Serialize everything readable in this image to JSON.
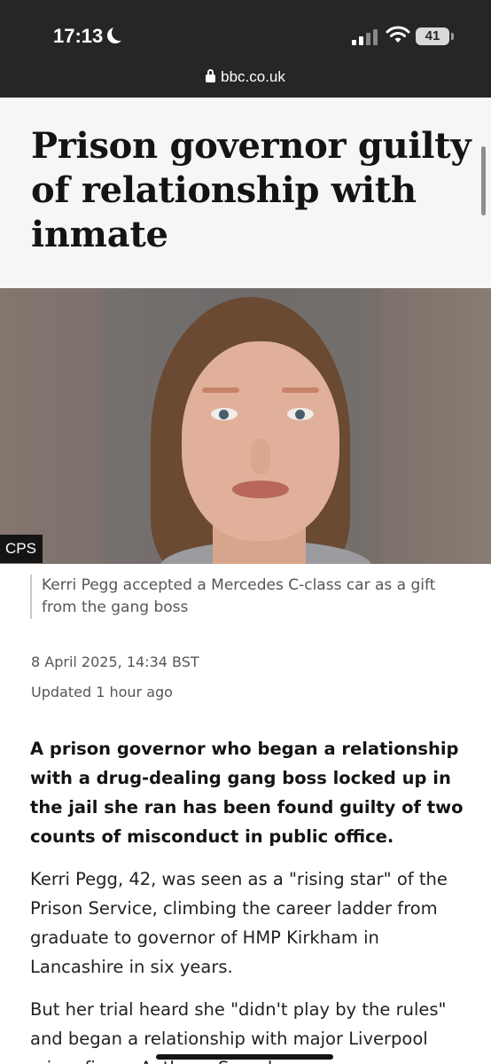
{
  "status_bar": {
    "time": "17:13",
    "battery": "41",
    "icons": [
      "moon-icon",
      "cellular-signal-icon",
      "wifi-icon",
      "battery-icon"
    ]
  },
  "browser": {
    "url": "bbc.co.uk"
  },
  "article": {
    "headline": "Prison governor guilty of relationship with inmate",
    "image_credit": "CPS",
    "caption": "Kerri Pegg accepted a Mercedes C-class car as a gift from the gang boss",
    "date": "8 April 2025, 14:34 BST",
    "updated": "Updated 1 hour ago",
    "lead": "A prison governor who began a relationship with a drug-dealing gang boss locked up in the jail she ran has been found guilty of two counts of misconduct in public office.",
    "paragraphs": [
      "Kerri Pegg, 42, was seen as a \"rising star\" of the Prison Service, climbing the career ladder from graduate to governor of HMP Kirkham in Lancashire in six years.",
      "But her trial heard she \"didn't play by the rules\" and began a relationship with major Liverpool crime figure Anthony Saunderson"
    ]
  },
  "colors": {
    "topbar": "#262626",
    "headline_bg": "#f6f6f6",
    "text": "#141414",
    "muted_text": "#545658"
  }
}
